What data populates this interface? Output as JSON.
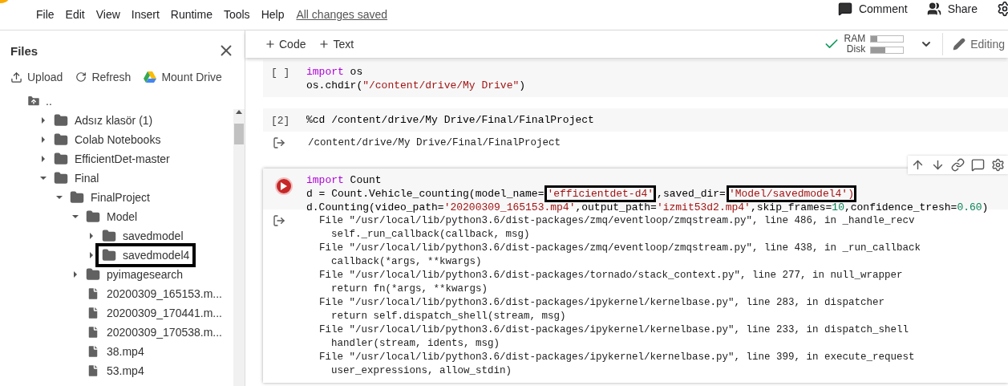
{
  "menu": [
    "File",
    "Edit",
    "View",
    "Insert",
    "Runtime",
    "Tools",
    "Help"
  ],
  "save_status": "All changes saved",
  "header_actions": [
    "Comment",
    "Share"
  ],
  "sidebar": {
    "title": "Files",
    "actions": [
      "Upload",
      "Refresh",
      "Mount Drive"
    ],
    "parent": "..",
    "tree": [
      {
        "name": "Adsız klasör (1)",
        "kind": "folder",
        "expanded": false,
        "boxed": false
      },
      {
        "name": "Colab Notebooks",
        "kind": "folder",
        "expanded": false,
        "boxed": false
      },
      {
        "name": "EfficientDet-master",
        "kind": "folder",
        "expanded": false,
        "boxed": false
      },
      {
        "name": "Final",
        "kind": "folder",
        "expanded": true,
        "boxed": false,
        "children": [
          {
            "name": "FinalProject",
            "kind": "folder",
            "expanded": true,
            "boxed": false,
            "children": [
              {
                "name": "Model",
                "kind": "folder",
                "expanded": true,
                "boxed": false,
                "children": [
                  {
                    "name": "savedmodel",
                    "kind": "folder",
                    "expanded": false,
                    "boxed": false
                  },
                  {
                    "name": "savedmodel4",
                    "kind": "folder",
                    "expanded": false,
                    "boxed": true
                  }
                ]
              },
              {
                "name": "pyimagesearch",
                "kind": "folder",
                "expanded": false,
                "boxed": false
              },
              {
                "name": "20200309_165153.m...",
                "kind": "file",
                "boxed": false
              },
              {
                "name": "20200309_170441.m...",
                "kind": "file",
                "boxed": false
              },
              {
                "name": "20200309_170538.m...",
                "kind": "file",
                "boxed": false
              },
              {
                "name": "38.mp4",
                "kind": "file",
                "boxed": false
              },
              {
                "name": "53.mp4",
                "kind": "file",
                "boxed": false
              }
            ]
          }
        ]
      }
    ]
  },
  "toolbar": {
    "add": [
      "Code",
      "Text"
    ],
    "ram": {
      "label": "RAM",
      "level": 0.2
    },
    "disk": {
      "label": "Disk",
      "level": 0.45
    },
    "mode": "Editing"
  },
  "cells": [
    {
      "kind": "code",
      "prompt": "[ ]",
      "selected": false,
      "lines": [
        [
          {
            "t": "import",
            "kind": "keyword"
          },
          {
            "t": " os",
            "kind": "plain"
          }
        ],
        [
          {
            "t": "os.chdir(",
            "kind": "plain"
          },
          {
            "t": "\"/content/drive/My Drive\"",
            "kind": "string"
          },
          {
            "t": ")",
            "kind": "plain"
          }
        ]
      ]
    },
    {
      "kind": "code",
      "prompt": "[2]",
      "selected": false,
      "lines": [
        [
          {
            "t": "%cd /content/drive/My Drive/Final/FinalProject",
            "kind": "plain"
          }
        ]
      ],
      "output": [
        "/content/drive/My Drive/Final/FinalProject"
      ]
    },
    {
      "kind": "code",
      "selected": true,
      "lines": [
        [
          {
            "t": "import",
            "kind": "keyword"
          },
          {
            "t": " Count",
            "kind": "plain"
          }
        ],
        [
          {
            "t": "d = Count.Vehicle_counting(model_name=",
            "kind": "plain"
          },
          {
            "t": "'efficientdet-d4'",
            "kind": "string",
            "boxed": true
          },
          {
            "t": ",saved_dir=",
            "kind": "plain"
          },
          {
            "t": "'Model/savedmodel4')",
            "kind": "string",
            "boxed": true
          }
        ],
        [
          {
            "t": "d.Counting(video_path=",
            "kind": "plain"
          },
          {
            "t": "'20200309_165153.mp4'",
            "kind": "string"
          },
          {
            "t": ",output_path=",
            "kind": "plain"
          },
          {
            "t": "'izmit53d2.mp4'",
            "kind": "string"
          },
          {
            "t": ",skip_frames=",
            "kind": "plain"
          },
          {
            "t": "10",
            "kind": "number"
          },
          {
            "t": ",confidence_tresh=",
            "kind": "plain"
          },
          {
            "t": "0.60",
            "kind": "number"
          },
          {
            "t": ")",
            "kind": "plain"
          }
        ]
      ],
      "output": [
        "File \"/usr/local/lib/python3.6/dist-packages/zmq/eventloop/zmqstream.py\", line 486, in _handle_recv",
        "  self._run_callback(callback, msg)",
        "File \"/usr/local/lib/python3.6/dist-packages/zmq/eventloop/zmqstream.py\", line 438, in _run_callback",
        "  callback(*args, **kwargs)",
        "File \"/usr/local/lib/python3.6/dist-packages/tornado/stack_context.py\", line 277, in null_wrapper",
        "  return fn(*args, **kwargs)",
        "File \"/usr/local/lib/python3.6/dist-packages/ipykernel/kernelbase.py\", line 283, in dispatcher",
        "  return self.dispatch_shell(stream, msg)",
        "File \"/usr/local/lib/python3.6/dist-packages/ipykernel/kernelbase.py\", line 233, in dispatch_shell",
        "  handler(stream, idents, msg)",
        "File \"/usr/local/lib/python3.6/dist-packages/ipykernel/kernelbase.py\", line 399, in execute_request",
        "  user_expressions, allow_stdin)"
      ]
    }
  ]
}
